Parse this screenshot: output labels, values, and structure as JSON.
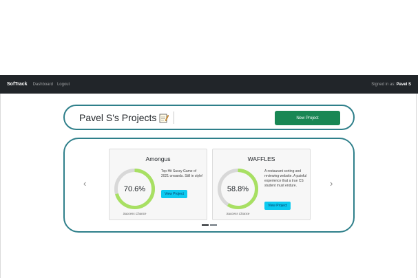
{
  "navbar": {
    "brand": "SofTrack",
    "links": [
      "Dashboard",
      "Logout"
    ],
    "signed_in_prefix": "Signed in as:",
    "signed_in_user": "Pavel S"
  },
  "header": {
    "title": "Pavel S's Projects",
    "title_icon": "memo-icon",
    "new_project_label": "New Project",
    "button_color": "#198754"
  },
  "carousel": {
    "prev_icon": "‹",
    "next_icon": "›",
    "indicator_count": 2,
    "active_indicator": 0,
    "projects": [
      {
        "name": "Amongus",
        "success_percent": 70.6,
        "success_label": "70.6%",
        "description": "Top Hit Sussy Game of 2021 onwards. Still in style!",
        "view_label": "View Project",
        "chance_label": "Success Chance"
      },
      {
        "name": "WAFFLES",
        "success_percent": 58.8,
        "success_label": "58.8%",
        "description": "A restaurant sorting and reviewing website. A painful experience that a true CS student must endure.",
        "view_label": "View Project",
        "chance_label": "Success Chance"
      }
    ]
  },
  "colors": {
    "navbar": "#212529",
    "border_accent": "#2e7f8a",
    "ring_fill": "#a8e063",
    "ring_track": "#d8d8d8",
    "view_button": "#0dcaf0"
  }
}
